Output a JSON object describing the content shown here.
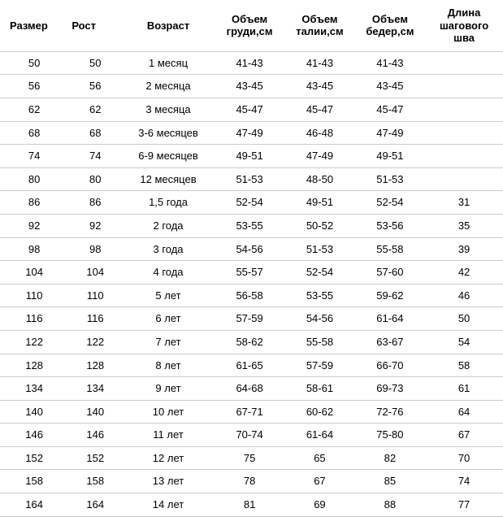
{
  "chart_data": {
    "type": "table",
    "columns": [
      "Размер",
      "Рост",
      "Возраст",
      "Объем груди,см",
      "Объем талии,см",
      "Объем бедер,см",
      "Длина шагового шва"
    ],
    "rows": [
      [
        "50",
        "50",
        "1 месяц",
        "41-43",
        "41-43",
        "41-43",
        ""
      ],
      [
        "56",
        "56",
        "2 месяца",
        "43-45",
        "43-45",
        "43-45",
        ""
      ],
      [
        "62",
        "62",
        "3 месяца",
        "45-47",
        "45-47",
        "45-47",
        ""
      ],
      [
        "68",
        "68",
        "3-6 месяцев",
        "47-49",
        "46-48",
        "47-49",
        ""
      ],
      [
        "74",
        "74",
        "6-9 месяцев",
        "49-51",
        "47-49",
        "49-51",
        ""
      ],
      [
        "80",
        "80",
        "12 месяцев",
        "51-53",
        "48-50",
        "51-53",
        ""
      ],
      [
        "86",
        "86",
        "1,5 года",
        "52-54",
        "49-51",
        "52-54",
        "31"
      ],
      [
        "92",
        "92",
        "2 года",
        "53-55",
        "50-52",
        "53-56",
        "35"
      ],
      [
        "98",
        "98",
        "3 года",
        "54-56",
        "51-53",
        "55-58",
        "39"
      ],
      [
        "104",
        "104",
        "4 года",
        "55-57",
        "52-54",
        "57-60",
        "42"
      ],
      [
        "110",
        "110",
        "5 лет",
        "56-58",
        "53-55",
        "59-62",
        "46"
      ],
      [
        "116",
        "116",
        "6 лет",
        "57-59",
        "54-56",
        "61-64",
        "50"
      ],
      [
        "122",
        "122",
        "7 лет",
        "58-62",
        "55-58",
        "63-67",
        "54"
      ],
      [
        "128",
        "128",
        "8 лет",
        "61-65",
        "57-59",
        "66-70",
        "58"
      ],
      [
        "134",
        "134",
        "9 лет",
        "64-68",
        "58-61",
        "69-73",
        "61"
      ],
      [
        "140",
        "140",
        "10 лет",
        "67-71",
        "60-62",
        "72-76",
        "64"
      ],
      [
        "146",
        "146",
        "11 лет",
        "70-74",
        "61-64",
        "75-80",
        "67"
      ],
      [
        "152",
        "152",
        "12 лет",
        "75",
        "65",
        "82",
        "70"
      ],
      [
        "158",
        "158",
        "13 лет",
        "78",
        "67",
        "85",
        "74"
      ],
      [
        "164",
        "164",
        "14 лет",
        "81",
        "69",
        "88",
        "77"
      ]
    ]
  }
}
